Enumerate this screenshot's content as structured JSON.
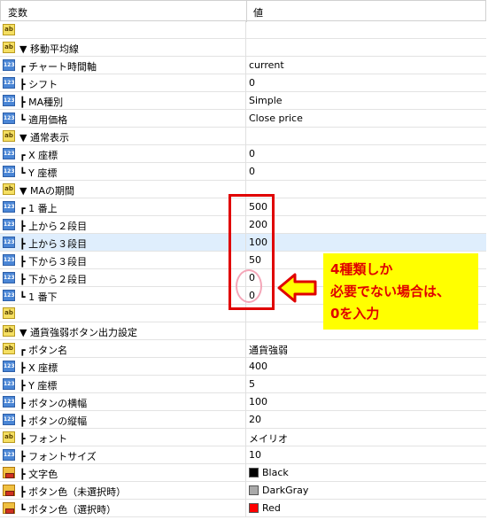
{
  "header": {
    "col_name": "変数",
    "col_value": "値"
  },
  "rows": [
    {
      "icon": "ab-icon",
      "name": "",
      "value": ""
    },
    {
      "icon": "ab-icon",
      "name": "▼ 移動平均線",
      "value": ""
    },
    {
      "icon": "123-icon",
      "name": "┏ チャート時間軸",
      "value": "current"
    },
    {
      "icon": "123-icon",
      "name": "┣ シフト",
      "value": "0"
    },
    {
      "icon": "123-icon",
      "name": "┣ MA種別",
      "value": "Simple"
    },
    {
      "icon": "123-icon",
      "name": "┗ 適用価格",
      "value": "Close price"
    },
    {
      "icon": "ab-icon",
      "name": "▼ 通常表示",
      "value": ""
    },
    {
      "icon": "123-icon",
      "name": "┏ X 座標",
      "value": "0"
    },
    {
      "icon": "123-icon",
      "name": "┗ Y 座標",
      "value": "0"
    },
    {
      "icon": "ab-icon",
      "name": "▼ MAの期間",
      "value": ""
    },
    {
      "icon": "123-icon",
      "name": "┏ 1 番上",
      "value": "500"
    },
    {
      "icon": "123-icon",
      "name": "┣ 上から２段目",
      "value": "200"
    },
    {
      "icon": "123-icon",
      "name": "┣ 上から３段目",
      "value": "100"
    },
    {
      "icon": "123-icon",
      "name": "┣ 下から３段目",
      "value": "50"
    },
    {
      "icon": "123-icon",
      "name": "┣ 下から２段目",
      "value": "0"
    },
    {
      "icon": "123-icon",
      "name": "┗ 1 番下",
      "value": "0"
    },
    {
      "icon": "ab-icon",
      "name": "",
      "value": ""
    },
    {
      "icon": "ab-icon",
      "name": "▼ 通貨強弱ボタン出力設定",
      "value": ""
    },
    {
      "icon": "ab-icon",
      "name": "┏ ボタン名",
      "value": "通貨強弱"
    },
    {
      "icon": "123-icon",
      "name": "┣ X 座標",
      "value": "400"
    },
    {
      "icon": "123-icon",
      "name": "┣ Y 座標",
      "value": "5"
    },
    {
      "icon": "123-icon",
      "name": "┣ ボタンの横幅",
      "value": "100"
    },
    {
      "icon": "123-icon",
      "name": "┣ ボタンの縦幅",
      "value": "20"
    },
    {
      "icon": "ab-icon",
      "name": "┣ フォント",
      "value": "メイリオ"
    },
    {
      "icon": "123-icon",
      "name": "┣ フォントサイズ",
      "value": "10"
    },
    {
      "icon": "color-icon",
      "name": "┣ 文字色",
      "value": "Black",
      "swatch": "#000000"
    },
    {
      "icon": "color-icon",
      "name": "┣ ボタン色（未選択時）",
      "value": "DarkGray",
      "swatch": "#a9a9a9"
    },
    {
      "icon": "color-icon",
      "name": "┗ ボタン色（選択時）",
      "value": "Red",
      "swatch": "#ff0000"
    }
  ],
  "selected_row": 12,
  "annotation": {
    "line1": "4種類しか",
    "line2": "必要でない場合は、",
    "line3": "0を入力",
    "text_color": "#e00000",
    "bg_color": "#ffff00",
    "box_color": "#e00000",
    "circle_color": "#f4a6b8"
  }
}
